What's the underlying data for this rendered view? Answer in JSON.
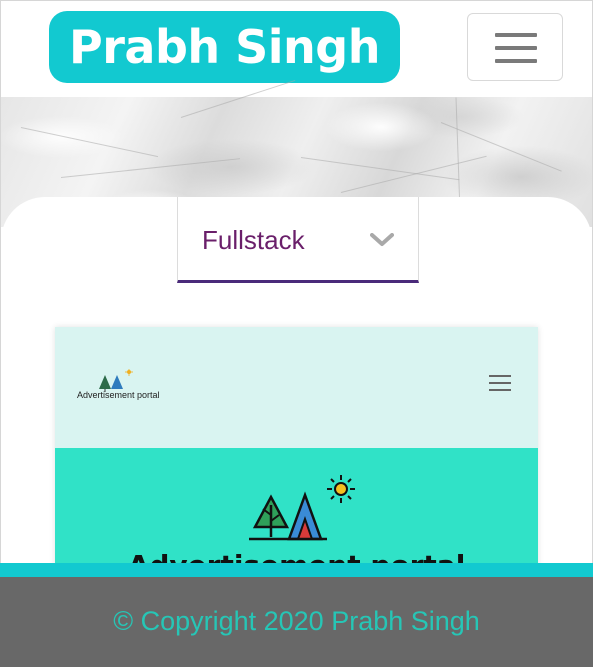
{
  "header": {
    "brand": "Prabh Singh",
    "menu_icon": "hamburger-menu-icon"
  },
  "filter": {
    "selected": "Fullstack",
    "chevron_icon": "chevron-down-icon"
  },
  "project_preview": {
    "logo_text": "Advertisement portal",
    "hero_title": "Advertisement portal",
    "menu_icon": "hamburger-menu-icon"
  },
  "footer": {
    "copyright": "© Copyright 2020 Prabh Singh"
  },
  "colors": {
    "brand": "#12c9d0",
    "dropdown_text": "#6a1f6a",
    "dropdown_underline": "#4a2a7a",
    "footer_bg": "#686868",
    "footer_text": "#26c6b6",
    "preview_hero": "#30e2c7"
  }
}
